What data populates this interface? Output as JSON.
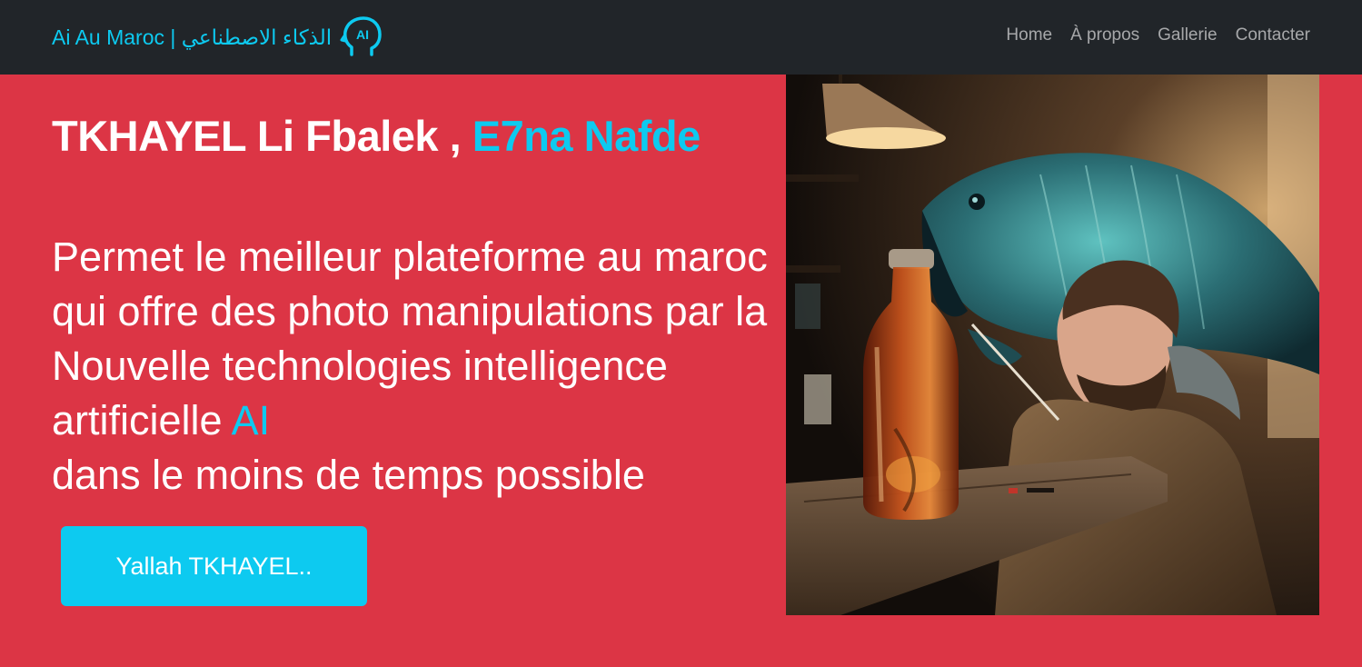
{
  "nav": {
    "brand_latin": "Ai Au Maroc | ",
    "brand_arabic": "الذكاء الاصطناعي",
    "logo_text": "AI",
    "links": [
      {
        "label": "Home"
      },
      {
        "label": "À propos"
      },
      {
        "label": "Gallerie"
      },
      {
        "label": "Contacter"
      }
    ]
  },
  "hero": {
    "title_main": "TKHAYEL Li Fbalek , ",
    "title_accent": "E7na Nafde",
    "description_main": "Permet le meilleur plateforme au maroc qui offre des photo manipulations par la Nouvelle technologies intelligence artificielle ",
    "description_ai": "AI",
    "description_end": "dans le moins de temps possible",
    "cta_label": "Yallah TKHAYEL.."
  },
  "colors": {
    "background": "#dc3545",
    "navbar": "#212529",
    "accent": "#0dcaf0"
  },
  "icons": {
    "logo": "ai-head-icon"
  }
}
